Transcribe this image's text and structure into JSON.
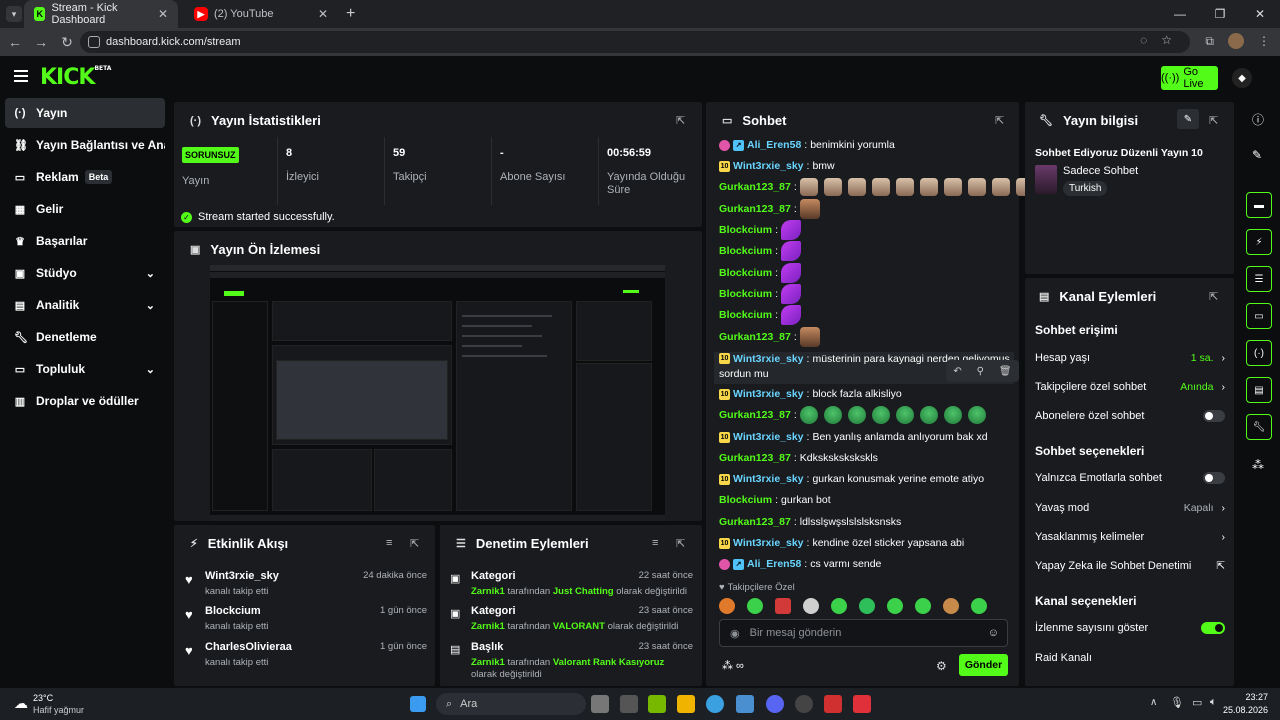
{
  "browser": {
    "tabs": [
      {
        "title": "Stream - Kick Dashboard"
      },
      {
        "title": "(2) YouTube"
      }
    ],
    "url": "dashboard.kick.com/stream"
  },
  "header": {
    "logo": "KICK",
    "logo_badge": "BETA",
    "go_live": "Go Live"
  },
  "sidebar": {
    "items": [
      {
        "label": "Yayın",
        "icon": "broadcast-icon"
      },
      {
        "label": "Yayın Bağlantısı ve Anahtarı",
        "icon": "link-icon"
      },
      {
        "label": "Reklam",
        "icon": "ad-icon",
        "badge": "Beta"
      },
      {
        "label": "Gelir",
        "icon": "chart-icon"
      },
      {
        "label": "Başarılar",
        "icon": "trophy-icon"
      },
      {
        "label": "Stüdyo",
        "icon": "studio-icon"
      },
      {
        "label": "Analitik",
        "icon": "analytics-icon"
      },
      {
        "label": "Denetleme",
        "icon": "wrench-icon"
      },
      {
        "label": "Topluluk",
        "icon": "community-icon"
      },
      {
        "label": "Droplar ve ödüller",
        "icon": "gift-icon"
      }
    ]
  },
  "stats": {
    "title": "Yayın İstatistikleri",
    "status_badge": "SORUNSUZ",
    "status_label": "Yayın",
    "viewers": {
      "value": "8",
      "label": "İzleyici"
    },
    "followers": {
      "value": "59",
      "label": "Takipçi"
    },
    "subs": {
      "value": "-",
      "label": "Abone Sayısı"
    },
    "uptime": {
      "value": "00:56:59",
      "label": "Yayında Olduğu Süre"
    },
    "success": "Stream started successfully."
  },
  "preview": {
    "title": "Yayın Ön İzlemesi"
  },
  "activity": {
    "title": "Etkinlik Akışı",
    "items": [
      {
        "name": "Wint3rxie_sky",
        "sub": "kanalı takip etti",
        "time": "24 dakika önce"
      },
      {
        "name": "Blockcium",
        "sub": "kanalı takip etti",
        "time": "1 gün önce"
      },
      {
        "name": "CharlesOlivieraa",
        "sub": "kanalı takip etti",
        "time": "1 gün önce"
      }
    ]
  },
  "moderation": {
    "title": "Denetim Eylemleri",
    "items": [
      {
        "name": "Kategori",
        "user": "Zarnik1",
        "mid": "tarafından",
        "value": "Just Chatting",
        "end": "olarak değiştirildi",
        "time": "22 saat önce"
      },
      {
        "name": "Kategori",
        "user": "Zarnik1",
        "mid": "tarafından",
        "value": "VALORANT",
        "end": "olarak değiştirildi",
        "time": "23 saat önce"
      },
      {
        "name": "Başlık",
        "user": "Zarnik1",
        "mid": "tarafından",
        "value": "Valorant Rank Kasıyoruz",
        "end": "olarak değiştirildi",
        "time": "23 saat önce"
      }
    ]
  },
  "chat": {
    "title": "Sohbet",
    "messages": [
      {
        "user": "Ali_Eren58",
        "text": "benimkini yorumla"
      },
      {
        "user": "Wint3rxie_sky",
        "text": "bmw"
      },
      {
        "user": "Gurkan123_87",
        "text": ""
      },
      {
        "user": "Gurkan123_87",
        "text": ""
      },
      {
        "user": "Blockcium",
        "text": ""
      },
      {
        "user": "Blockcium",
        "text": ""
      },
      {
        "user": "Blockcium",
        "text": ""
      },
      {
        "user": "Blockcium",
        "text": ""
      },
      {
        "user": "Blockcium",
        "text": ""
      },
      {
        "user": "Gurkan123_87",
        "text": ""
      },
      {
        "user": "Wint3rxie_sky",
        "text": "müsterinin para kaynagi nerden geliyomus"
      },
      {
        "user": "",
        "text": "sordun mu"
      },
      {
        "user": "Wint3rxie_sky",
        "text": "block fazla alkisliyo"
      },
      {
        "user": "Gurkan123_87",
        "text": ""
      },
      {
        "user": "Wint3rxie_sky",
        "text": "Ben yanlış anlamda anlıyorum bak xd"
      },
      {
        "user": "Gurkan123_87",
        "text": "Kdkskskskskskls"
      },
      {
        "user": "Wint3rxie_sky",
        "text": "gurkan konusmak yerine emote atiyo"
      },
      {
        "user": "Blockcium",
        "text": "gurkan bot"
      },
      {
        "user": "Gurkan123_87",
        "text": "ldlsslşwşslslslsksnsks"
      },
      {
        "user": "Wint3rxie_sky",
        "text": "kendine özel sticker yapsana abi"
      },
      {
        "user": "Ali_Eren58",
        "text": "cs varmı sende"
      }
    ],
    "followers_only": "Takipçilere Özel",
    "input_placeholder": "Bir mesaj gönderin",
    "send": "Gönder"
  },
  "stream_info": {
    "title": "Yayın bilgisi",
    "stream_title": "Sohbet Ediyoruz Düzenli Yayın 10",
    "category": "Sadece Sohbet",
    "language": "Turkish"
  },
  "channel_actions": {
    "title": "Kanal Eylemleri",
    "chat_access": "Sohbet erişimi",
    "account_age": {
      "label": "Hesap yaşı",
      "value": "1 sa."
    },
    "followers_chat": {
      "label": "Takipçilere özel sohbet",
      "value": "Anında"
    },
    "subs_chat": {
      "label": "Abonelere özel sohbet"
    },
    "chat_options": "Sohbet seçenekleri",
    "emote_only": {
      "label": "Yalnızca Emotlarla sohbet"
    },
    "slow_mode": {
      "label": "Yavaş mod",
      "value": "Kapalı"
    },
    "banned_words": {
      "label": "Yasaklanmış kelimeler"
    },
    "ai_mod": {
      "label": "Yapay Zeka ile Sohbet Denetimi"
    },
    "channel_options": "Kanal seçenekleri",
    "show_viewers": {
      "label": "İzlenme sayısını göster"
    },
    "raid": {
      "label": "Raid Kanalı"
    }
  },
  "taskbar": {
    "weather_temp": "23°C",
    "weather_desc": "Hafif yağmur",
    "search": "Ara",
    "time": "23:27",
    "date": "25.08.2026"
  },
  "colors": {
    "accent": "#53fc18",
    "panel": "#191b1f",
    "bg": "#0b0d0f"
  }
}
